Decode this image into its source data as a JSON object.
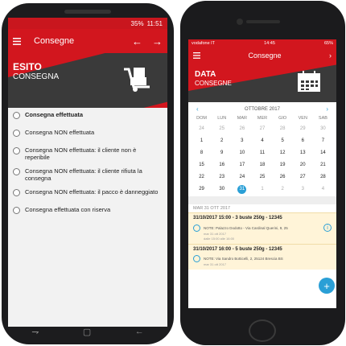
{
  "android": {
    "status": {
      "battery": "35%",
      "time": "11:51"
    },
    "toolbar": {
      "title": "Consegne",
      "back_arrow": "←",
      "forward_arrow": "→"
    },
    "hero": {
      "title": "ESITO",
      "subtitle": "CONSEGNA"
    },
    "options": [
      {
        "label": "Consegna effettuata"
      },
      {
        "label": "Consegna NON effettuata"
      },
      {
        "label": "Consegna NON effettuata: il cliente non è reperibile"
      },
      {
        "label": "Consegna NON effettuata: il cliente rifiuta la consegna"
      },
      {
        "label": "Consegna NON effettuata: il pacco è danneggiato"
      },
      {
        "label": "Consegna effettuata con riserva"
      }
    ]
  },
  "iphone": {
    "status": {
      "carrier": "vodafone IT",
      "time": "14:45",
      "battery": "65%"
    },
    "toolbar": {
      "title": "Consegne",
      "chevron": "›"
    },
    "hero": {
      "title": "DATA",
      "subtitle": "CONSEGNE"
    },
    "calendar": {
      "month": "OTTOBRE 2017",
      "weekdays": [
        "DOM",
        "LUN",
        "MAR",
        "MER",
        "GIO",
        "VEN",
        "SAB"
      ],
      "rows": [
        [
          "24",
          "25",
          "26",
          "27",
          "28",
          "29",
          "30"
        ],
        [
          "1",
          "2",
          "3",
          "4",
          "5",
          "6",
          "7"
        ],
        [
          "8",
          "9",
          "10",
          "11",
          "12",
          "13",
          "14"
        ],
        [
          "15",
          "16",
          "17",
          "18",
          "19",
          "20",
          "21"
        ],
        [
          "22",
          "23",
          "24",
          "25",
          "26",
          "27",
          "28"
        ],
        [
          "29",
          "30",
          "31",
          "1",
          "2",
          "3",
          "4"
        ]
      ],
      "selected": "31"
    },
    "date_label": "MAR 31 OTT 2017",
    "events": [
      {
        "header": "31/10/2017 15:00 - 3 buste 250g - 12345",
        "note": "NOTE: Palazzo Dodotto - Via Cardinal Querini, 9, 25",
        "sub1": "mar 31 ott 2017",
        "sub2": "dalle 15:00 alle 16:00"
      },
      {
        "header": "31/10/2017 16:00 - 5 buste 250g - 12345",
        "note": "NOTE: Via Sandro Botticelli, 2, 25124 Brescia BS",
        "sub1": "mar 31 ott 2017"
      }
    ],
    "fab": "+"
  }
}
